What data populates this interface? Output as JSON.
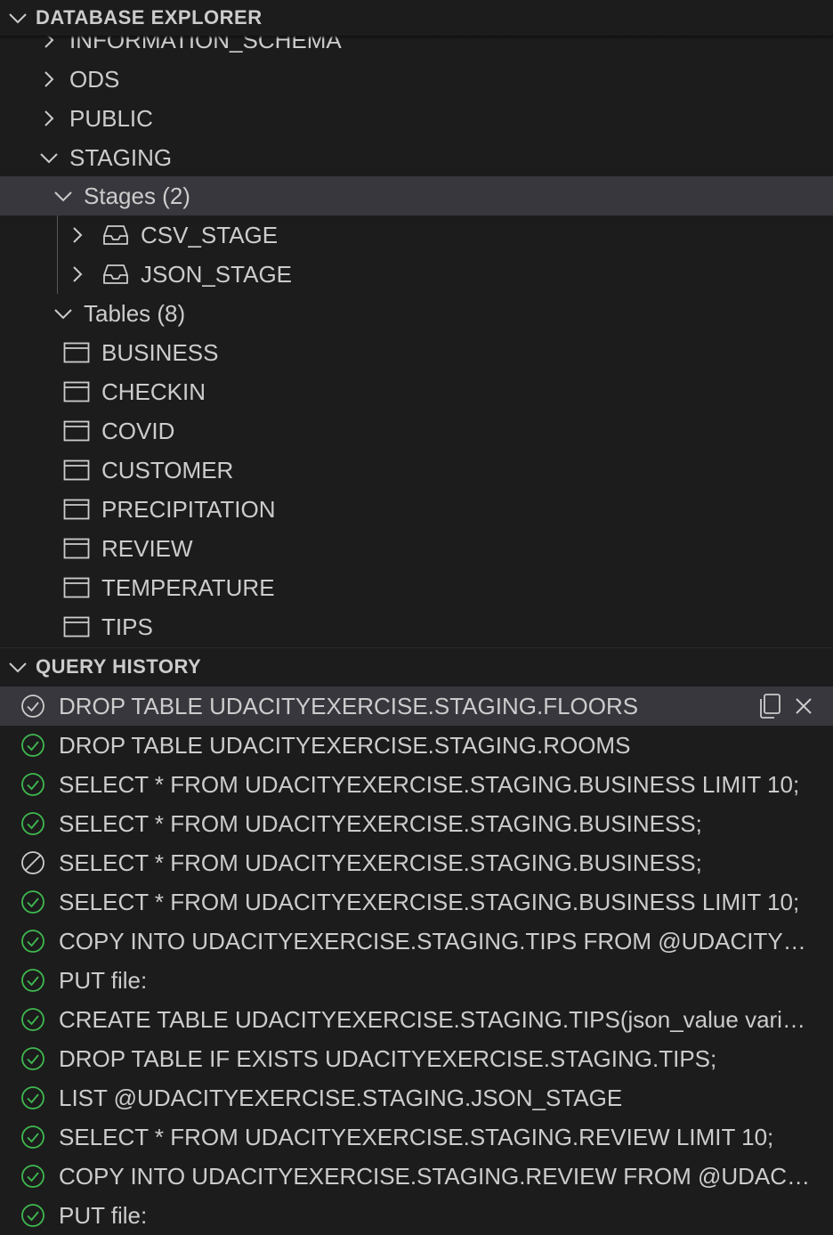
{
  "explorer": {
    "title": "DATABASE EXPLORER",
    "schemas": [
      {
        "label": "INFORMATION_SCHEMA"
      },
      {
        "label": "ODS"
      },
      {
        "label": "PUBLIC"
      },
      {
        "label": "STAGING"
      }
    ],
    "stages_group": "Stages (2)",
    "stages": [
      {
        "label": "CSV_STAGE"
      },
      {
        "label": "JSON_STAGE"
      }
    ],
    "tables_group": "Tables (8)",
    "tables": [
      {
        "label": "BUSINESS"
      },
      {
        "label": "CHECKIN"
      },
      {
        "label": "COVID"
      },
      {
        "label": "CUSTOMER"
      },
      {
        "label": "PRECIPITATION"
      },
      {
        "label": "REVIEW"
      },
      {
        "label": "TEMPERATURE"
      },
      {
        "label": "TIPS"
      }
    ]
  },
  "history": {
    "title": "QUERY HISTORY",
    "items": [
      {
        "text": "DROP TABLE UDACITYEXERCISE.STAGING.FLOORS",
        "status": "success"
      },
      {
        "text": "DROP TABLE UDACITYEXERCISE.STAGING.ROOMS",
        "status": "success"
      },
      {
        "text": "SELECT * FROM UDACITYEXERCISE.STAGING.BUSINESS LIMIT 10;",
        "status": "success"
      },
      {
        "text": "SELECT * FROM UDACITYEXERCISE.STAGING.BUSINESS;",
        "status": "success"
      },
      {
        "text": "SELECT * FROM UDACITYEXERCISE.STAGING.BUSINESS;",
        "status": "cancelled"
      },
      {
        "text": "SELECT * FROM UDACITYEXERCISE.STAGING.BUSINESS LIMIT 10;",
        "status": "success"
      },
      {
        "text": "COPY INTO UDACITYEXERCISE.STAGING.TIPS FROM @UDACITYEX…",
        "status": "success"
      },
      {
        "text": "PUT file:",
        "status": "success"
      },
      {
        "text": "CREATE TABLE UDACITYEXERCISE.STAGING.TIPS(json_value variant);",
        "status": "success"
      },
      {
        "text": "DROP TABLE IF EXISTS UDACITYEXERCISE.STAGING.TIPS;",
        "status": "success"
      },
      {
        "text": "LIST @UDACITYEXERCISE.STAGING.JSON_STAGE",
        "status": "success"
      },
      {
        "text": "SELECT * FROM UDACITYEXERCISE.STAGING.REVIEW LIMIT 10;",
        "status": "success"
      },
      {
        "text": "COPY INTO UDACITYEXERCISE.STAGING.REVIEW FROM @UDACITY…",
        "status": "success"
      },
      {
        "text": "PUT file:",
        "status": "success"
      }
    ]
  },
  "colors": {
    "background": "#1c1c1c",
    "selected_row": "#37373d",
    "success": "#3fb950",
    "text": "#cccccc"
  }
}
